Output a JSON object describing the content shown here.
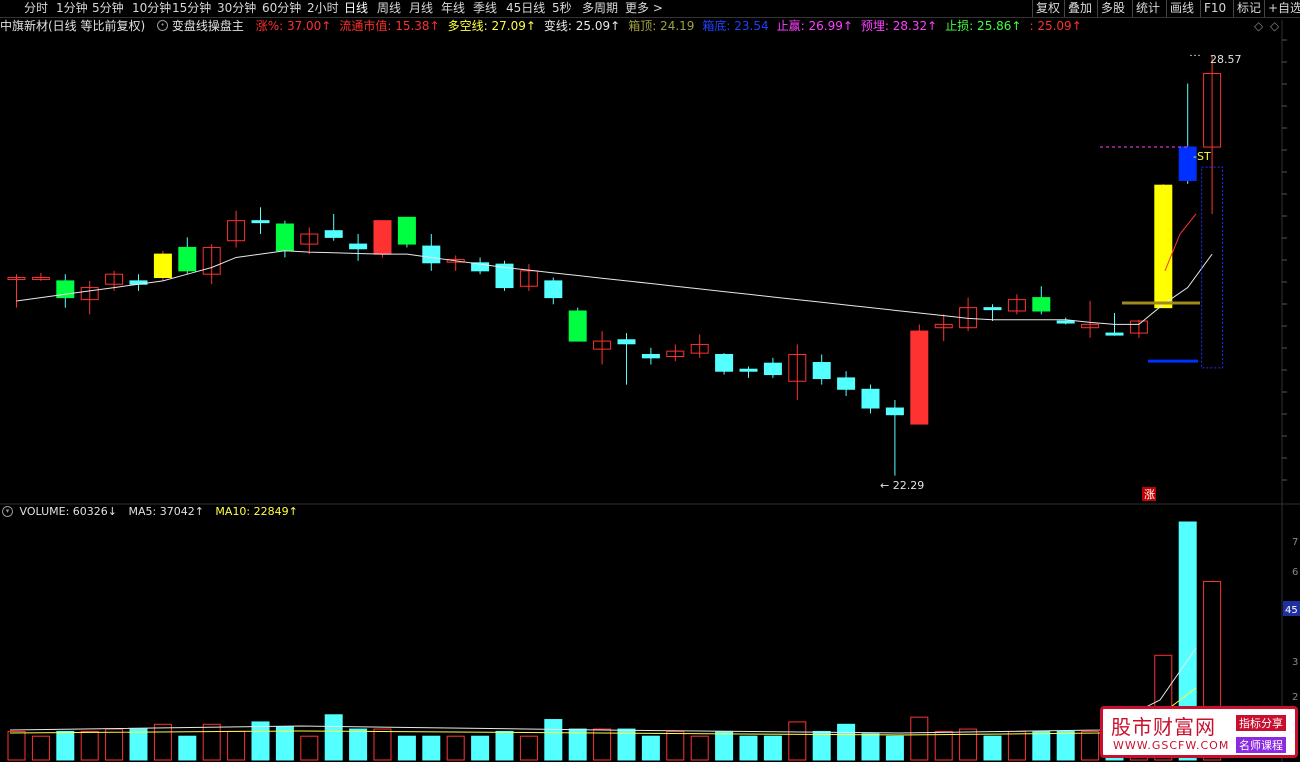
{
  "toolbar": {
    "periods": [
      "分时",
      "1分钟",
      "5分钟",
      "10分钟",
      "15分钟",
      "30分钟",
      "60分钟",
      "2小时",
      "日线",
      "周线",
      "月线",
      "年线",
      "季线",
      "45日线",
      "5秒",
      "多周期",
      "更多 >"
    ],
    "active": "日线",
    "right_items": [
      "复权",
      "叠加",
      "多股",
      "统计",
      "画线",
      "F10",
      "标记",
      "+自选"
    ]
  },
  "indicator": {
    "title": "中旗新材(日线 等比前复权)",
    "formula": "变盘线操盘主",
    "items": [
      {
        "label": "涨%: 37.00↑",
        "color": "#ff3030"
      },
      {
        "label": "流通市值: 15.38↑",
        "color": "#ff3030"
      },
      {
        "label": "多空线: 27.09↑",
        "color": "#ffff40"
      },
      {
        "label": "变线: 25.09↑",
        "color": "#e8e8e8"
      },
      {
        "label": "箱顶: 24.19",
        "color": "#a0a040"
      },
      {
        "label": "箱底: 23.54",
        "color": "#2040ff"
      },
      {
        "label": "止赢: 26.99↑",
        "color": "#ff40ff"
      },
      {
        "label": "预埋: 28.32↑",
        "color": "#ff40ff"
      },
      {
        "label": "止损: 25.86↑",
        "color": "#40ff40"
      },
      {
        "label": ": 25.09↑",
        "color": "#ff3030"
      }
    ]
  },
  "price_labels": {
    "high": "28.57",
    "low": "22.29",
    "st": "-ST",
    "zhang": "涨"
  },
  "volume": {
    "label": "VOLUME: 60326↓",
    "ma5": "MA5: 37042↑",
    "ma10": "MA10: 22849↑",
    "right_tag": "45"
  },
  "right_axis_vol": [
    "7",
    "6",
    "4",
    "3",
    "2"
  ],
  "colors": {
    "up": "#ff3232",
    "down": "#54ffff",
    "green_signal": "#00ff40",
    "yellow_signal": "#ffff00",
    "blue_signal": "#0030ff",
    "ma": "#e8e8e8",
    "vol_ma5": "#e8e8e8",
    "vol_ma10": "#ffff40"
  },
  "chart_data": {
    "type": "candlestick",
    "candles": [
      {
        "o": 25.25,
        "h": 25.3,
        "l": 24.8,
        "c": 25.25,
        "s": "up"
      },
      {
        "o": 25.25,
        "h": 25.32,
        "l": 25.2,
        "c": 25.25,
        "s": "up"
      },
      {
        "o": 24.95,
        "h": 25.3,
        "l": 24.8,
        "c": 25.2,
        "s": "green"
      },
      {
        "o": 24.92,
        "h": 25.2,
        "l": 24.7,
        "c": 25.1,
        "s": "up"
      },
      {
        "o": 25.15,
        "h": 25.35,
        "l": 25.05,
        "c": 25.3,
        "s": "up"
      },
      {
        "o": 25.2,
        "h": 25.3,
        "l": 25.05,
        "c": 25.15,
        "s": "down"
      },
      {
        "o": 25.25,
        "h": 25.65,
        "l": 25.2,
        "c": 25.6,
        "s": "yellow"
      },
      {
        "o": 25.35,
        "h": 25.85,
        "l": 25.3,
        "c": 25.7,
        "s": "green"
      },
      {
        "o": 25.3,
        "h": 25.75,
        "l": 25.15,
        "c": 25.7,
        "s": "up"
      },
      {
        "o": 25.8,
        "h": 26.25,
        "l": 25.7,
        "c": 26.1,
        "s": "up"
      },
      {
        "o": 26.1,
        "h": 26.3,
        "l": 25.9,
        "c": 26.1,
        "s": "down"
      },
      {
        "o": 25.65,
        "h": 26.1,
        "l": 25.55,
        "c": 26.05,
        "s": "green"
      },
      {
        "o": 25.75,
        "h": 26.0,
        "l": 25.6,
        "c": 25.9,
        "s": "up"
      },
      {
        "o": 25.95,
        "h": 26.2,
        "l": 25.8,
        "c": 25.85,
        "s": "down"
      },
      {
        "o": 25.75,
        "h": 25.9,
        "l": 25.5,
        "c": 25.68,
        "s": "down"
      },
      {
        "o": 25.6,
        "h": 26.1,
        "l": 25.55,
        "c": 26.1,
        "s": "red"
      },
      {
        "o": 25.75,
        "h": 26.15,
        "l": 25.7,
        "c": 26.15,
        "s": "green"
      },
      {
        "o": 25.72,
        "h": 25.9,
        "l": 25.35,
        "c": 25.47,
        "s": "down"
      },
      {
        "o": 25.52,
        "h": 25.58,
        "l": 25.35,
        "c": 25.48,
        "s": "up"
      },
      {
        "o": 25.47,
        "h": 25.55,
        "l": 25.3,
        "c": 25.35,
        "s": "down"
      },
      {
        "o": 25.45,
        "h": 25.5,
        "l": 25.05,
        "c": 25.1,
        "s": "down"
      },
      {
        "o": 25.12,
        "h": 25.45,
        "l": 25.05,
        "c": 25.35,
        "s": "up"
      },
      {
        "o": 25.2,
        "h": 25.25,
        "l": 24.85,
        "c": 24.95,
        "s": "down"
      },
      {
        "o": 24.3,
        "h": 24.8,
        "l": 24.3,
        "c": 24.75,
        "s": "green"
      },
      {
        "o": 24.18,
        "h": 24.45,
        "l": 23.95,
        "c": 24.3,
        "s": "up"
      },
      {
        "o": 24.32,
        "h": 24.42,
        "l": 23.65,
        "c": 24.26,
        "s": "down"
      },
      {
        "o": 24.05,
        "h": 24.2,
        "l": 23.95,
        "c": 24.1,
        "s": "down"
      },
      {
        "o": 24.07,
        "h": 24.25,
        "l": 24.0,
        "c": 24.15,
        "s": "up"
      },
      {
        "o": 24.12,
        "h": 24.4,
        "l": 24.05,
        "c": 24.25,
        "s": "up"
      },
      {
        "o": 24.1,
        "h": 24.12,
        "l": 23.8,
        "c": 23.85,
        "s": "down"
      },
      {
        "o": 23.85,
        "h": 23.92,
        "l": 23.75,
        "c": 23.88,
        "s": "down"
      },
      {
        "o": 23.97,
        "h": 24.05,
        "l": 23.75,
        "c": 23.8,
        "s": "down"
      },
      {
        "o": 23.7,
        "h": 24.25,
        "l": 23.42,
        "c": 24.1,
        "s": "up"
      },
      {
        "o": 23.98,
        "h": 24.1,
        "l": 23.65,
        "c": 23.74,
        "s": "down"
      },
      {
        "o": 23.75,
        "h": 23.85,
        "l": 23.48,
        "c": 23.58,
        "s": "down"
      },
      {
        "o": 23.58,
        "h": 23.65,
        "l": 23.22,
        "c": 23.3,
        "s": "down"
      },
      {
        "o": 23.3,
        "h": 23.42,
        "l": 22.29,
        "c": 23.2,
        "s": "down"
      },
      {
        "o": 23.06,
        "h": 24.55,
        "l": 23.06,
        "c": 24.45,
        "s": "red"
      },
      {
        "o": 24.5,
        "h": 24.7,
        "l": 24.3,
        "c": 24.55,
        "s": "up"
      },
      {
        "o": 24.5,
        "h": 24.95,
        "l": 24.45,
        "c": 24.8,
        "s": "up"
      },
      {
        "o": 24.8,
        "h": 24.85,
        "l": 24.6,
        "c": 24.8,
        "s": "down"
      },
      {
        "o": 24.75,
        "h": 25.0,
        "l": 24.7,
        "c": 24.92,
        "s": "up"
      },
      {
        "o": 24.95,
        "h": 25.12,
        "l": 24.7,
        "c": 24.75,
        "s": "green"
      },
      {
        "o": 24.6,
        "h": 24.65,
        "l": 24.55,
        "c": 24.6,
        "s": "down"
      },
      {
        "o": 24.5,
        "h": 24.9,
        "l": 24.35,
        "c": 24.55,
        "s": "up"
      },
      {
        "o": 24.4,
        "h": 24.72,
        "l": 24.38,
        "c": 24.42,
        "s": "down"
      },
      {
        "o": 24.42,
        "h": 24.62,
        "l": 24.35,
        "c": 24.6,
        "s": "up"
      },
      {
        "o": 24.8,
        "h": 26.65,
        "l": 24.8,
        "c": 26.63,
        "s": "yellow"
      },
      {
        "o": 26.7,
        "h": 28.15,
        "l": 26.65,
        "c": 27.2,
        "s": "blue"
      },
      {
        "o": 27.2,
        "h": 28.57,
        "l": 26.2,
        "c": 28.3,
        "s": "up"
      }
    ],
    "ma": [
      24.9,
      24.95,
      25.0,
      25.05,
      25.1,
      25.15,
      25.2,
      25.3,
      25.4,
      25.55,
      25.6,
      25.65,
      25.63,
      25.62,
      25.61,
      25.6,
      25.6,
      25.55,
      25.5,
      25.45,
      25.4,
      25.36,
      25.32,
      25.28,
      25.24,
      25.2,
      25.16,
      25.12,
      25.08,
      25.04,
      25.0,
      24.96,
      24.92,
      24.88,
      24.84,
      24.8,
      24.76,
      24.72,
      24.68,
      24.64,
      24.62,
      24.62,
      24.62,
      24.62,
      24.58,
      24.55,
      24.55,
      24.85,
      25.1,
      25.6
    ],
    "volume_relative": [
      0.12,
      0.1,
      0.12,
      0.12,
      0.13,
      0.13,
      0.15,
      0.1,
      0.15,
      0.12,
      0.16,
      0.14,
      0.1,
      0.19,
      0.13,
      0.13,
      0.1,
      0.1,
      0.1,
      0.1,
      0.12,
      0.1,
      0.17,
      0.13,
      0.13,
      0.13,
      0.1,
      0.12,
      0.1,
      0.12,
      0.1,
      0.1,
      0.16,
      0.12,
      0.15,
      0.11,
      0.1,
      0.18,
      0.12,
      0.13,
      0.1,
      0.12,
      0.12,
      0.12,
      0.12,
      0.14,
      0.14,
      0.44,
      1.0,
      0.75
    ]
  }
}
